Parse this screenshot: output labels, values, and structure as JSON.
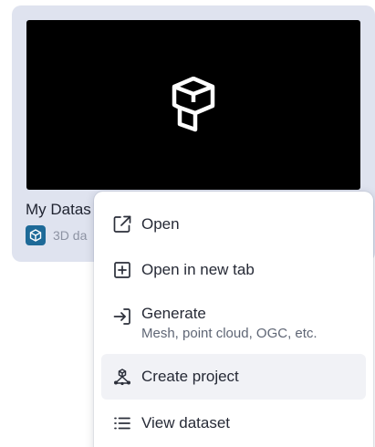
{
  "card": {
    "title": "My Datas",
    "type_label": "3D da",
    "thumbnail_icon": "logo-icon",
    "type_icon": "cube-icon",
    "badge_color": "#1e6a98"
  },
  "menu": {
    "items": [
      {
        "label": "Open",
        "icon": "external-link-icon"
      },
      {
        "label": "Open in new tab",
        "icon": "plus-square-icon"
      },
      {
        "label": "Generate",
        "sublabel": "Mesh, point cloud, OGC, etc.",
        "icon": "arrow-into-icon"
      },
      {
        "label": "Create project",
        "icon": "project-nodes-icon",
        "highlighted": true
      },
      {
        "label": "View dataset",
        "icon": "list-icon"
      }
    ]
  },
  "colors": {
    "card_background": "#dfe3ef",
    "thumbnail_background": "#000000",
    "menu_highlight": "#f1f2f6",
    "text_primary": "#262a36",
    "text_secondary": "#5f6675"
  }
}
